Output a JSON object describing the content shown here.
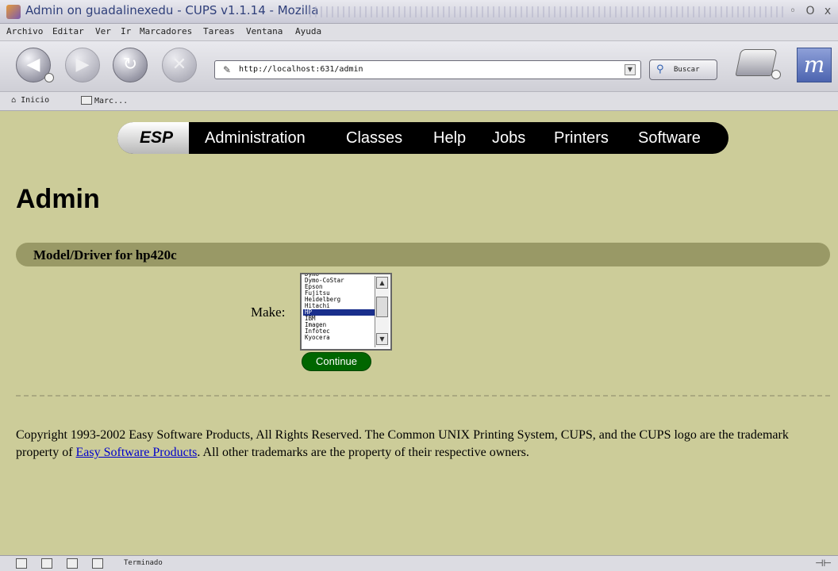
{
  "window": {
    "title": "Admin on guadalinexedu - CUPS v1.1.14 - Mozilla",
    "controls": {
      "minimize": "◦",
      "maximize": "O",
      "close": "x"
    }
  },
  "menubar": {
    "items": [
      "Archivo",
      "Editar",
      "Ver",
      "Ir",
      "Marcadores",
      "Tareas",
      "Ventana",
      "Ayuda"
    ]
  },
  "navbar": {
    "back_icon": "back-arrow-icon",
    "forward_icon": "forward-arrow-icon",
    "reload_icon": "reload-icon",
    "stop_icon": "stop-icon",
    "url": "http://localhost:631/admin",
    "search_label": "Buscar",
    "print_icon": "printer-icon",
    "logo_text": "m"
  },
  "personalbar": {
    "home_label": "Inicio",
    "bookmarks_label": "Marc..."
  },
  "cups_nav": {
    "esp_label": "ESP",
    "tabs": [
      "Administration",
      "Classes",
      "Help",
      "Jobs",
      "Printers",
      "Software"
    ]
  },
  "page": {
    "title": "Admin",
    "section_title": "Model/Driver for hp420c",
    "make_label": "Make:",
    "make_options": [
      "Dymo",
      "Dymo-CoStar",
      "Epson",
      "Fujitsu",
      "Heidelberg",
      "Hitachi",
      "HP",
      "IBM",
      "Imagen",
      "Infotec",
      "Kyocera"
    ],
    "make_selected": "HP",
    "continue_label": "Continue"
  },
  "footer": {
    "text_before": "Copyright 1993-2002 Easy Software Products, All Rights Reserved. The Common UNIX Printing System, CUPS, and the CUPS logo are the trademark property of ",
    "link_text": "Easy Software Products",
    "text_after": ". All other trademarks are the property of their respective owners."
  },
  "statusbar": {
    "text": "Terminado"
  },
  "colors": {
    "page_background": "#cccc99",
    "section_header": "#999966",
    "nav_pill": "#000000",
    "continue_button": "#006600",
    "link": "#0000cc",
    "selection": "#1a2f8c"
  }
}
